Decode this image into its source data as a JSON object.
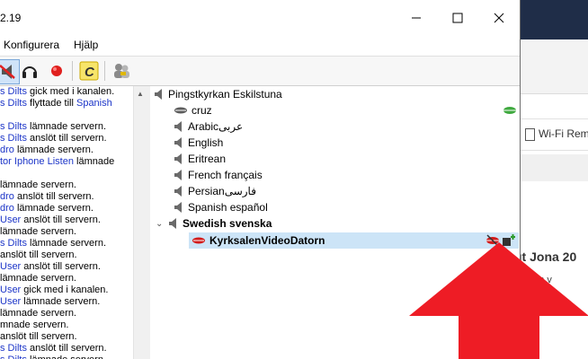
{
  "window": {
    "title": "2.19",
    "controls": {
      "minimize": "—",
      "maximize": "☐",
      "close": "✕"
    }
  },
  "menus": [
    "Konfigurera",
    "Hjälp"
  ],
  "toolbar": {
    "buttons": [
      "mute-speaker-icon",
      "headphones-icon",
      "record-icon",
      "console-icon",
      "users-icon"
    ],
    "console_label": "C"
  },
  "log": {
    "lines": [
      {
        "user": "s Dilts",
        "text": " gick med i kanalen."
      },
      {
        "user": "s Dilts",
        "text": " flyttade till ",
        "extra": "Spanish"
      },
      {
        "user": "",
        "text": ""
      },
      {
        "user": "s Dilts",
        "text": " lämnade servern."
      },
      {
        "user": "s Dilts",
        "text": " anslöt till servern."
      },
      {
        "user": "dro",
        "text": " lämnade servern."
      },
      {
        "user": "tor Iphone Listen",
        "text": " lämnade"
      },
      {
        "user": "",
        "text": ""
      },
      {
        "user": "",
        "text": " lämnade servern."
      },
      {
        "user": "dro",
        "text": " anslöt till servern."
      },
      {
        "user": "dro",
        "text": " lämnade servern."
      },
      {
        "user": "User",
        "text": " anslöt till servern."
      },
      {
        "user": "",
        "text": " lämnade servern."
      },
      {
        "user": "s Dilts",
        "text": " lämnade servern."
      },
      {
        "user": "",
        "text": " anslöt till servern."
      },
      {
        "user": "User",
        "text": " anslöt till servern."
      },
      {
        "user": "",
        "text": " lämnade servern."
      },
      {
        "user": "User",
        "text": " gick med i kanalen."
      },
      {
        "user": "User",
        "text": " lämnade servern."
      },
      {
        "user": "",
        "text": " lämnade servern."
      },
      {
        "user": "",
        "text": "mnade servern."
      },
      {
        "user": "",
        "text": " anslöt till servern."
      },
      {
        "user": "s Dilts",
        "text": " anslöt till servern."
      },
      {
        "user": "s Dilts",
        "text": " lämnade servern."
      }
    ]
  },
  "tree": {
    "root": "Pingstkyrkan Eskilstuna",
    "channels": [
      {
        "name": "cruz",
        "kind": "user"
      },
      {
        "name": "Arabicعربى",
        "kind": "channel"
      },
      {
        "name": "English",
        "kind": "channel"
      },
      {
        "name": "Eritrean",
        "kind": "channel"
      },
      {
        "name": "French français",
        "kind": "channel"
      },
      {
        "name": "Persianفارسی",
        "kind": "channel"
      },
      {
        "name": "Spanish español",
        "kind": "channel"
      }
    ],
    "expanded_channel": "Swedish svenska",
    "selected_user": "KyrksalenVideoDatorn"
  },
  "background_window": {
    "tab_label": "Wi-Fi Rem",
    "heading": "gt Jona 20",
    "subtext": "pen tills v"
  },
  "colors": {
    "accent_arrow": "#ee1c25",
    "link_user": "#1c35c8",
    "selection": "#cce4f7"
  }
}
